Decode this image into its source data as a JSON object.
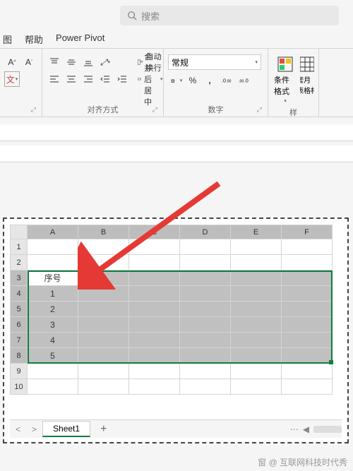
{
  "search": {
    "placeholder": "搜索"
  },
  "tabs": {
    "view": "图",
    "help": "帮助",
    "powerpivot": "Power Pivot"
  },
  "ribbon": {
    "font": {
      "size_up": "A",
      "size_down": "A",
      "wen": "文"
    },
    "align": {
      "wrap": "自动换行",
      "merge": "合并后居中",
      "group_label": "对齐方式"
    },
    "number": {
      "format": "常规",
      "group_label": "数字",
      "percent": "%",
      "comma": ","
    },
    "styles": {
      "cond_format": "条件格式",
      "as_table": "套月\n表格样",
      "group_label": "样"
    }
  },
  "grid": {
    "cols": [
      "A",
      "B",
      "C",
      "D",
      "E",
      "F"
    ],
    "rows": [
      "1",
      "2",
      "3",
      "4",
      "5",
      "6",
      "7",
      "8",
      "9",
      "10"
    ],
    "cells": {
      "A3": "序号",
      "A4": "1",
      "A5": "2",
      "A6": "3",
      "A7": "4",
      "A8": "5"
    }
  },
  "sheets": {
    "active": "Sheet1",
    "add": "+"
  },
  "watermark": "窗 @ 互联网科技时代秀"
}
